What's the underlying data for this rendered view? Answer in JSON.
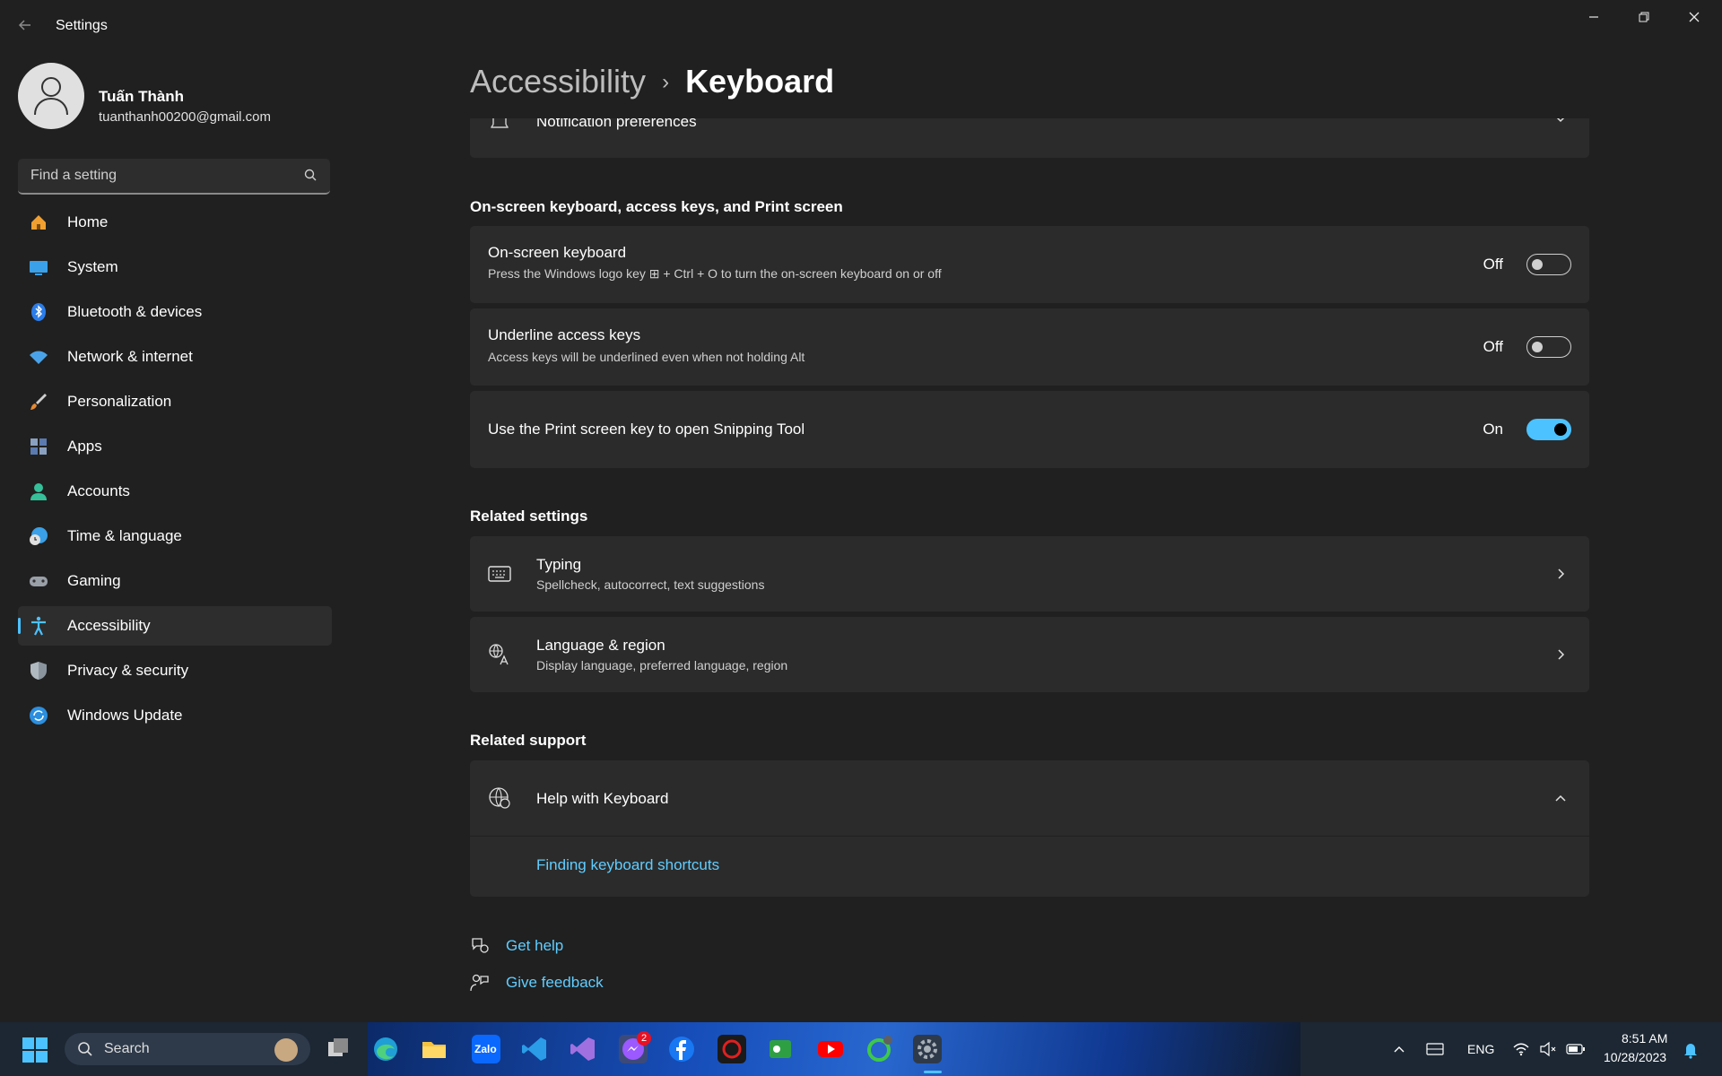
{
  "window": {
    "title": "Settings",
    "minimize": "—",
    "restore": "❐",
    "close": "✕"
  },
  "profile": {
    "name": "Tuấn Thành",
    "email": "tuanthanh00200@gmail.com"
  },
  "search": {
    "placeholder": "Find a setting"
  },
  "nav": {
    "items": [
      {
        "label": "Home",
        "icon": "home-icon",
        "color": "#f0a030"
      },
      {
        "label": "System",
        "icon": "system-icon",
        "color": "#3aa0e8"
      },
      {
        "label": "Bluetooth & devices",
        "icon": "bluetooth-icon",
        "color": "#2b7de9"
      },
      {
        "label": "Network & internet",
        "icon": "wifi-icon",
        "color": "#4aa3e8"
      },
      {
        "label": "Personalization",
        "icon": "brush-icon",
        "color": "#e88a30"
      },
      {
        "label": "Apps",
        "icon": "apps-icon",
        "color": "#8aa0c0"
      },
      {
        "label": "Accounts",
        "icon": "accounts-icon",
        "color": "#35c09a"
      },
      {
        "label": "Time & language",
        "icon": "clock-globe-icon",
        "color": "#3aa0e8"
      },
      {
        "label": "Gaming",
        "icon": "gamepad-icon",
        "color": "#9aa0a8"
      },
      {
        "label": "Accessibility",
        "icon": "accessibility-icon",
        "color": "#4cc2ff"
      },
      {
        "label": "Privacy & security",
        "icon": "shield-icon",
        "color": "#8a949e"
      },
      {
        "label": "Windows Update",
        "icon": "update-icon",
        "color": "#2b8fe0"
      }
    ],
    "active_index": 9
  },
  "breadcrumb": {
    "parent": "Accessibility",
    "separator": "›",
    "current": "Keyboard"
  },
  "notification_row": {
    "label": "Notification preferences"
  },
  "onscreen_section": {
    "title": "On-screen keyboard, access keys, and Print screen",
    "rows": [
      {
        "title": "On-screen keyboard",
        "subtitle": "Press the Windows logo key ⊞ + Ctrl + O to turn the on-screen keyboard on or off",
        "state": "Off",
        "on": false
      },
      {
        "title": "Underline access keys",
        "subtitle": "Access keys will be underlined even when not holding Alt",
        "state": "Off",
        "on": false
      },
      {
        "title": "Use the Print screen key to open Snipping Tool",
        "subtitle": "",
        "state": "On",
        "on": true
      }
    ]
  },
  "related_settings": {
    "title": "Related settings",
    "rows": [
      {
        "title": "Typing",
        "subtitle": "Spellcheck, autocorrect, text suggestions",
        "icon": "keyboard-icon"
      },
      {
        "title": "Language & region",
        "subtitle": "Display language, preferred language, region",
        "icon": "language-icon"
      }
    ]
  },
  "related_support": {
    "title": "Related support",
    "help_title": "Help with Keyboard",
    "help_link": "Finding keyboard shortcuts"
  },
  "footer_links": {
    "get_help": "Get help",
    "give_feedback": "Give feedback"
  },
  "taskbar": {
    "search_label": "Search",
    "apps": [
      "task-view",
      "edge",
      "file-explorer",
      "zalo",
      "vscode",
      "visual-studio",
      "messenger",
      "facebook",
      "garena",
      "cisco-packet-tracer",
      "youtube",
      "app-green",
      "settings"
    ],
    "zalo_label": "Zalo",
    "messenger_badge": "2",
    "language": "ENG",
    "time": "8:51 AM",
    "date": "10/28/2023"
  },
  "colors": {
    "accent": "#4cc2ff",
    "link": "#60cdff",
    "background": "#202020",
    "card": "#2b2b2b"
  }
}
